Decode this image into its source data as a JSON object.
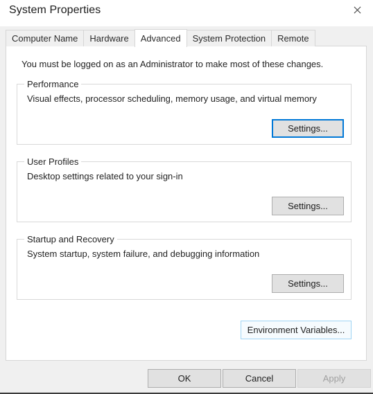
{
  "window": {
    "title": "System Properties",
    "close_icon": "close-icon"
  },
  "tabs": [
    {
      "label": "Computer Name",
      "selected": false
    },
    {
      "label": "Hardware",
      "selected": false
    },
    {
      "label": "Advanced",
      "selected": true
    },
    {
      "label": "System Protection",
      "selected": false
    },
    {
      "label": "Remote",
      "selected": false
    }
  ],
  "content": {
    "notice": "You must be logged on as an Administrator to make most of these changes.",
    "groups": [
      {
        "title": "Performance",
        "description": "Visual effects, processor scheduling, memory usage, and virtual memory",
        "button_label": "Settings..."
      },
      {
        "title": "User Profiles",
        "description": "Desktop settings related to your sign-in",
        "button_label": "Settings..."
      },
      {
        "title": "Startup and Recovery",
        "description": "System startup, system failure, and debugging information",
        "button_label": "Settings..."
      }
    ],
    "environment_variables_label": "Environment Variables..."
  },
  "footer": {
    "ok_label": "OK",
    "cancel_label": "Cancel",
    "apply_label": "Apply"
  },
  "colors": {
    "accent": "#0078d7",
    "hover_border": "#9fd4f4",
    "button_face": "#e1e1e1",
    "dialog_background": "#f0f0f0",
    "panel_background": "#ffffff",
    "text": "#222222",
    "disabled_text": "#a0a0a0"
  }
}
